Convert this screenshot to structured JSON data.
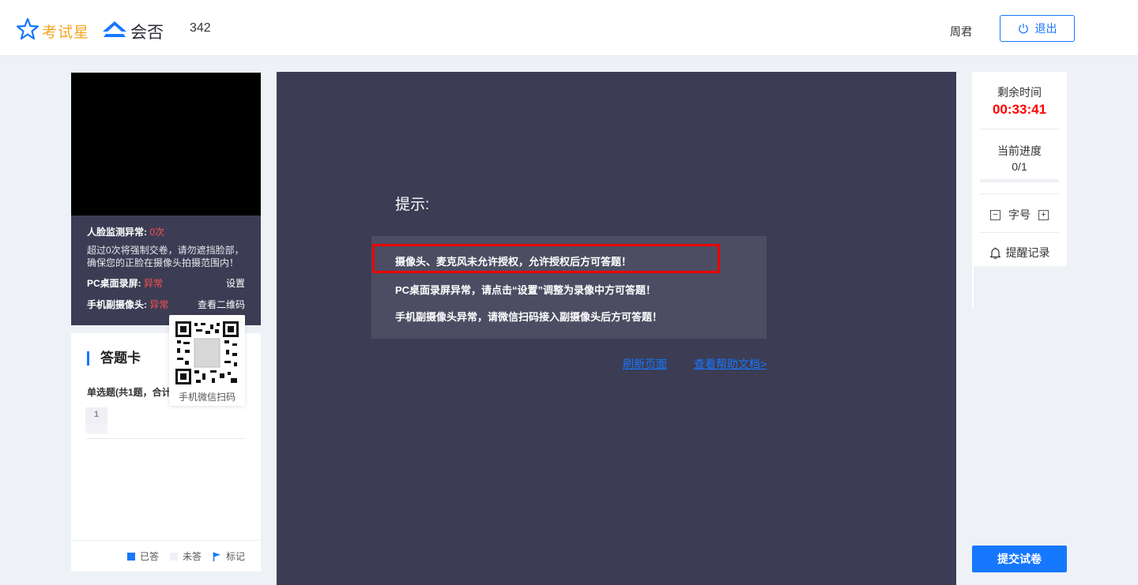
{
  "header": {
    "brand_name": "考试星",
    "partner_name": "会否",
    "exam_id": "342",
    "user_name": "周君",
    "logout_label": "退出"
  },
  "monitor": {
    "face_label": "人脸监测异常:",
    "face_count": "0次",
    "warning_text": "超过0次将强制交卷，请勿遮挡脸部，确保您的正脸在摄像头拍摄范围内！",
    "pc_label": "PC桌面录屏:",
    "pc_status": "异常",
    "pc_action": "设置",
    "mobile_label": "手机副摄像头:",
    "mobile_status": "异常",
    "mobile_action": "查看二维码",
    "qr_caption": "手机微信扫码"
  },
  "answer_card": {
    "title": "答题卡",
    "section_label": "单选题(共1题，合计",
    "questions": [
      "1"
    ],
    "legend": {
      "answered": "已答",
      "unanswered": "未答",
      "marked": "标记"
    }
  },
  "notice": {
    "title": "提示:",
    "lines": [
      "摄像头、麦克风未允许授权，允许授权后方可答题！",
      "PC桌面录屏异常，请点击“设置”调整为录像中方可答题！",
      "手机副摄像头异常，请微信扫码接入副摄像头后方可答题！"
    ],
    "refresh_link": "刷新页面",
    "help_link": "查看帮助文档>"
  },
  "side": {
    "time_label": "剩余时间",
    "time_value": "00:33:41",
    "progress_label": "当前进度",
    "progress_value": "0/1",
    "progress_fraction": 0,
    "font_label": "字号",
    "font_minus": "−",
    "font_plus": "+",
    "remind_label": "提醒记录",
    "submit_label": "提交试卷"
  },
  "colors": {
    "accent": "#1677ff",
    "warning": "#ff4d4f",
    "panel_dark": "#3c3d54",
    "highlight_border": "#ee0000"
  }
}
